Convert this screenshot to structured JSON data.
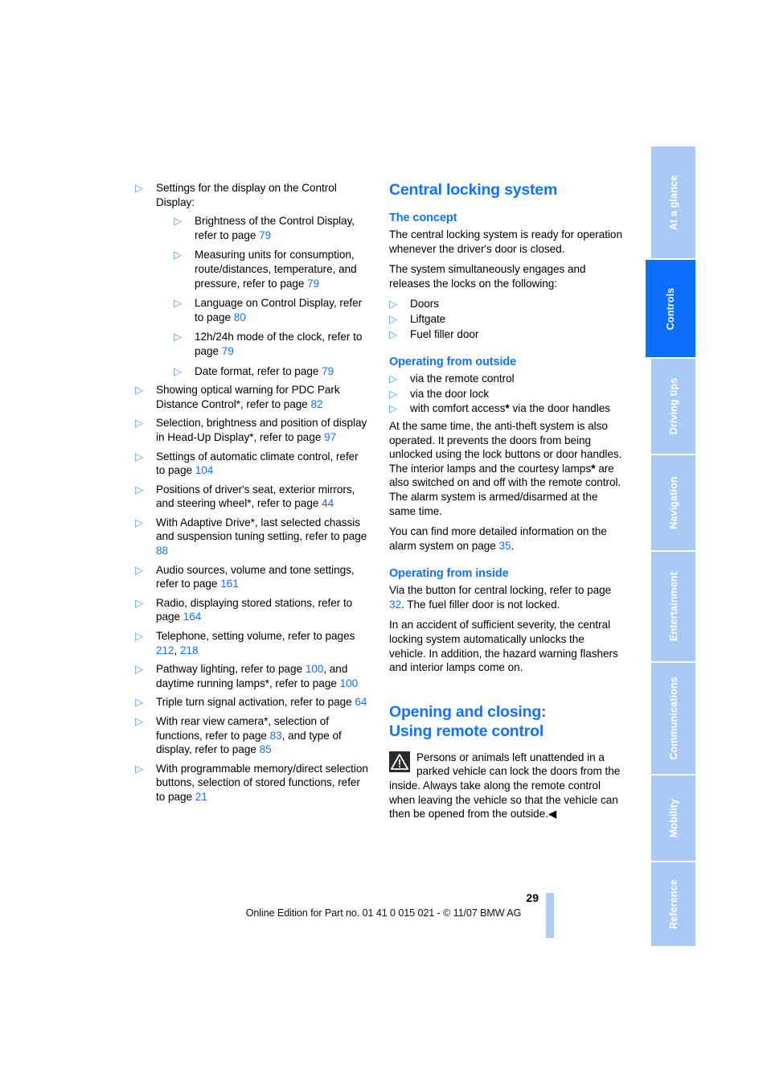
{
  "document": {
    "page_number": "29",
    "footer_credit": "Online Edition for Part no. 01 41 0 015 021 - © 11/07 BMW AG"
  },
  "sidebar": {
    "tabs": [
      {
        "label": "At a glance",
        "active": false
      },
      {
        "label": "Controls",
        "active": true
      },
      {
        "label": "Driving tips",
        "active": false
      },
      {
        "label": "Navigation",
        "active": false
      },
      {
        "label": "Entertainment",
        "active": false
      },
      {
        "label": "Communications",
        "active": false
      },
      {
        "label": "Mobility",
        "active": false
      },
      {
        "label": "Reference",
        "active": false
      }
    ]
  },
  "left_column": {
    "items": [
      {
        "text_before": "Settings for the display on the Control Display:",
        "sub_items": [
          {
            "text_before": "Brightness of the Control Display, refer to page ",
            "page": "79",
            "text_after": ""
          },
          {
            "text_before": "Measuring units for consumption, route/distances, temperature, and pressure, refer to page ",
            "page": "79",
            "text_after": ""
          },
          {
            "text_before": "Language on Control Display, refer to page ",
            "page": "80",
            "text_after": ""
          },
          {
            "text_before": "12h/24h mode of the clock, refer to page ",
            "page": "79",
            "text_after": ""
          },
          {
            "text_before": "Date format, refer to page ",
            "page": "79",
            "text_after": ""
          }
        ]
      },
      {
        "text_before": "Showing optical warning for PDC Park Distance Control*, refer to page ",
        "page": "82",
        "text_after": ""
      },
      {
        "text_before": "Selection, brightness and position of display in Head-Up Display*, refer to page ",
        "page": "97",
        "text_after": ""
      },
      {
        "text_before": "Settings of automatic climate control, refer to page ",
        "page": "104",
        "text_after": ""
      },
      {
        "text_before": "Positions of driver's seat, exterior mirrors, and steering wheel*, refer to page ",
        "page": "44",
        "text_after": ""
      },
      {
        "text_before": "With Adaptive Drive*, last selected chassis and suspension tuning setting, refer to page ",
        "page": "88",
        "text_after": ""
      },
      {
        "text_before": "Audio sources, volume and tone settings, refer to page ",
        "page": "161",
        "text_after": ""
      },
      {
        "text_before": "Radio, displaying stored stations, refer to page ",
        "page": "164",
        "text_after": ""
      },
      {
        "text_before": "Telephone, setting volume, refer to pages ",
        "page": "212",
        "text_mid": ", ",
        "page2": "218",
        "text_after": ""
      },
      {
        "text_before": "Pathway lighting, refer to page ",
        "page": "100",
        "text_mid": ", and daytime running lamps*, refer to page ",
        "page2": "100",
        "text_after": ""
      },
      {
        "text_before": "Triple turn signal activation, refer to page ",
        "page": "64",
        "text_after": ""
      },
      {
        "text_before": "With rear view camera*, selection of functions, refer to page ",
        "page": "83",
        "text_mid": ", and type of display, refer to page ",
        "page2": "85",
        "text_after": ""
      },
      {
        "text_before": "With programmable memory/direct selection buttons, selection of stored functions, refer to page ",
        "page": "21",
        "text_after": ""
      }
    ]
  },
  "right_column": {
    "heading_central_locking": "Central locking system",
    "concept": {
      "heading": "The concept",
      "paragraph_1": "The central locking system is ready for operation whenever the driver's door is closed.",
      "paragraph_2": "The system simultaneously engages and releases the locks on the following:",
      "items": [
        "Doors",
        "Liftgate",
        "Fuel filler door"
      ]
    },
    "outside": {
      "heading": "Operating from outside",
      "items": [
        {
          "text": "via the remote control",
          "asterisk": false
        },
        {
          "text": "via the door lock",
          "asterisk": false
        },
        {
          "text_before": "with comfort access",
          "asterisk": true,
          "text_after": " via the door handles"
        }
      ],
      "paragraph_1_part_a": "At the same time, the anti-theft system is also operated. It prevents the doors from being unlocked using the lock buttons or door handles. The interior lamps and the courtesy lamps",
      "paragraph_1_part_b": " are also switched on and off with the remote control. The alarm system is armed/disarmed at the same time.",
      "paragraph_2_before": "You can find more detailed information on the alarm system on page ",
      "paragraph_2_page": "35",
      "paragraph_2_after": "."
    },
    "inside": {
      "heading": "Operating from inside",
      "paragraph_1_before": "Via the button for central locking, refer to page ",
      "paragraph_1_page": "32",
      "paragraph_1_after": ". The fuel filler door is not locked.",
      "paragraph_2": "In an accident of sufficient severity, the central locking system automatically unlocks the vehicle. In addition, the hazard warning flashers and interior lamps come on."
    },
    "opening_closing": {
      "heading_line_1": "Opening and closing:",
      "heading_line_2": "Using remote control",
      "warning_text": "Persons or animals left unattended in a parked vehicle can lock the doors from the inside. Always take along the remote control when leaving the vehicle so that the vehicle can then be opened from the outside.",
      "warning_end_mark": "◀"
    }
  },
  "colors": {
    "accent_blue": "#1272ff",
    "bullet_blue": "#4a9bff",
    "tab_inactive": "#a8caf5",
    "tab_active": "#0d6efd",
    "footer_bar": "#aecbf5"
  }
}
